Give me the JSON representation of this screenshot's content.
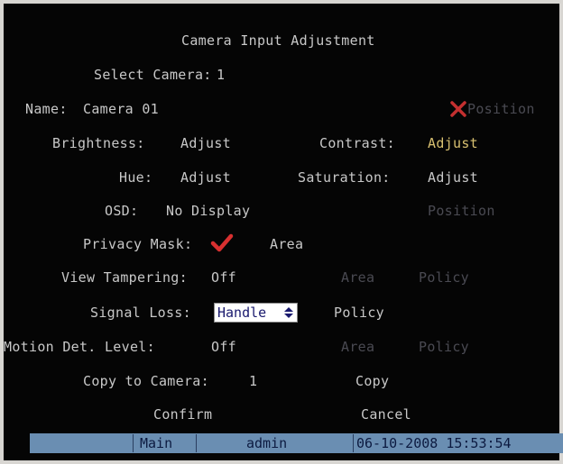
{
  "title": "Camera Input Adjustment",
  "select_camera": {
    "label": "Select Camera:",
    "value": "1"
  },
  "name": {
    "label": "Name:",
    "value": "Camera 01"
  },
  "position_top": {
    "label": "Position"
  },
  "brightness": {
    "label": "Brightness:",
    "action": "Adjust"
  },
  "contrast": {
    "label": "Contrast:",
    "action": "Adjust"
  },
  "hue": {
    "label": "Hue:",
    "action": "Adjust"
  },
  "saturation": {
    "label": "Saturation:",
    "action": "Adjust"
  },
  "osd": {
    "label": "OSD:",
    "value": "No Display",
    "position": "Position"
  },
  "privacy_mask": {
    "label": "Privacy Mask:",
    "checked": true,
    "area": "Area"
  },
  "view_tampering": {
    "label": "View Tampering:",
    "value": "Off",
    "area": "Area",
    "policy": "Policy"
  },
  "signal_loss": {
    "label": "Signal Loss:",
    "value": "Handle",
    "policy": "Policy"
  },
  "motion_det": {
    "label": "Motion Det. Level:",
    "value": "Off",
    "area": "Area",
    "policy": "Policy"
  },
  "copy_to_camera": {
    "label": "Copy to Camera:",
    "value": "1",
    "copy": "Copy"
  },
  "buttons": {
    "confirm": "Confirm",
    "cancel": "Cancel"
  },
  "statusbar": {
    "menu": "Main",
    "user": "admin",
    "datetime": "06-10-2008 15:53:54"
  },
  "colors": {
    "background": "#050505",
    "text": "#c8c8c8",
    "highlight": "#d8c070",
    "disabled": "#4a4a52",
    "check": "#d83030",
    "statusbar": "#6a8eb2"
  }
}
